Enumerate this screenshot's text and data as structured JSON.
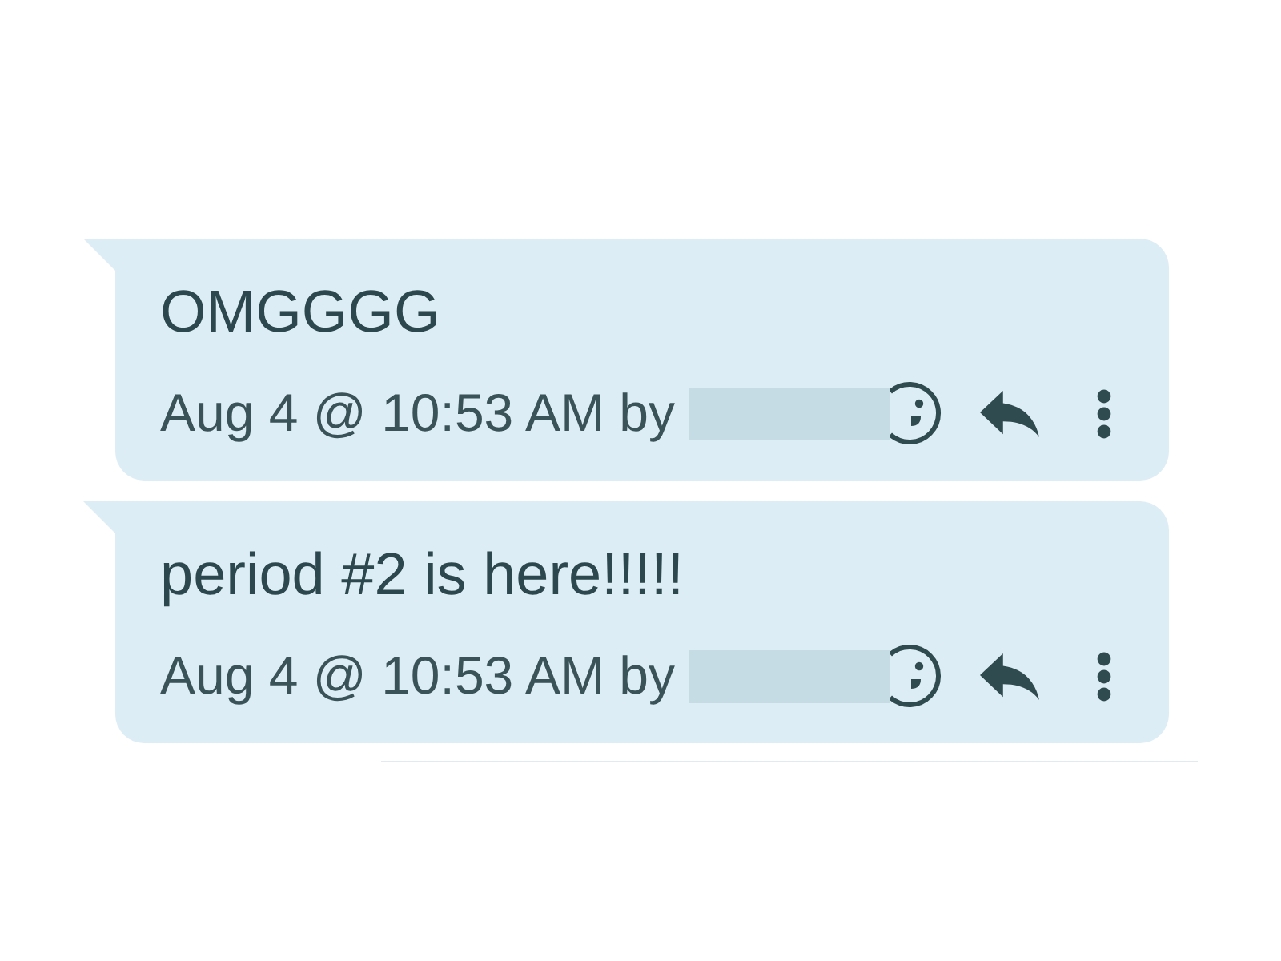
{
  "messages": [
    {
      "text": "OMGGGG",
      "meta": "Aug 4 @ 10:53 AM by",
      "author_hidden": true
    },
    {
      "text": "period #2 is here!!!!!",
      "meta": "Aug 4 @ 10:53 AM by",
      "author_hidden": true
    }
  ]
}
